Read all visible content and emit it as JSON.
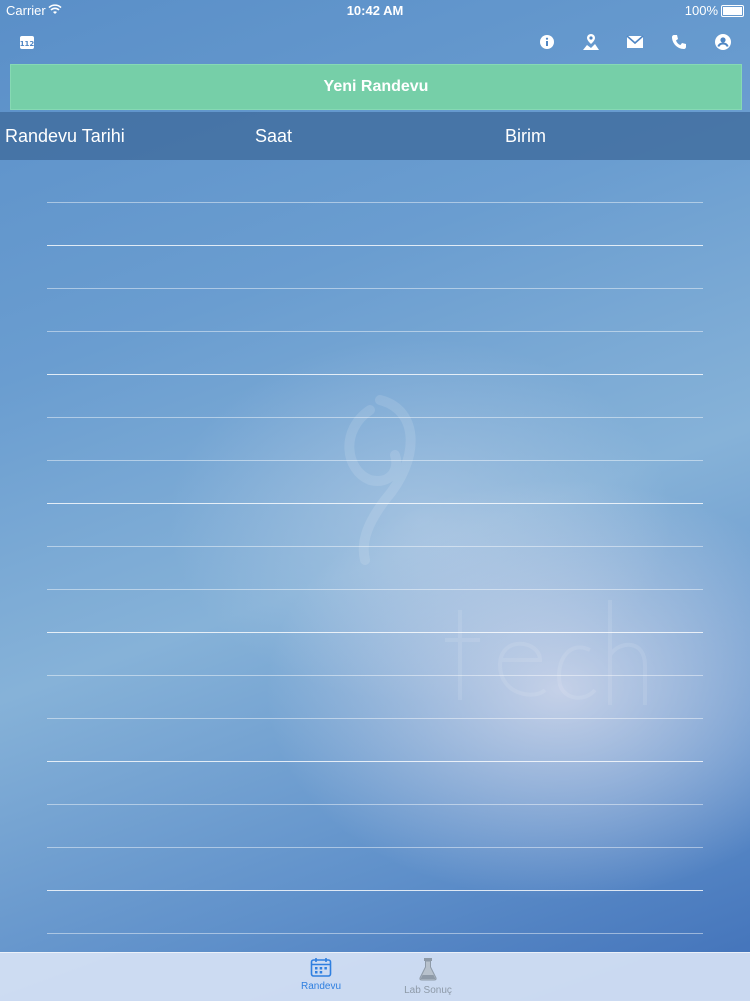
{
  "status_bar": {
    "carrier": "Carrier",
    "time": "10:42 AM",
    "battery": "100%"
  },
  "nav": {
    "left_icon": "calendar-112-icon",
    "right_icons": [
      "info-icon",
      "map-icon",
      "mail-icon",
      "phone-icon",
      "account-icon"
    ]
  },
  "new_appointment_button": "Yeni Randevu",
  "table": {
    "columns": [
      "Randevu Tarihi",
      "Saat",
      "Birim"
    ],
    "rows": []
  },
  "tabs": [
    {
      "label": "Randevu",
      "icon": "calendar-icon",
      "active": true
    },
    {
      "label": "Lab Sonuç",
      "icon": "flask-icon",
      "active": false
    }
  ],
  "colors": {
    "accent_green": "#76cfa8",
    "active_tab": "#2f7fe0",
    "inactive_tab": "#8e9aa8"
  },
  "nav_badge_text": "112"
}
